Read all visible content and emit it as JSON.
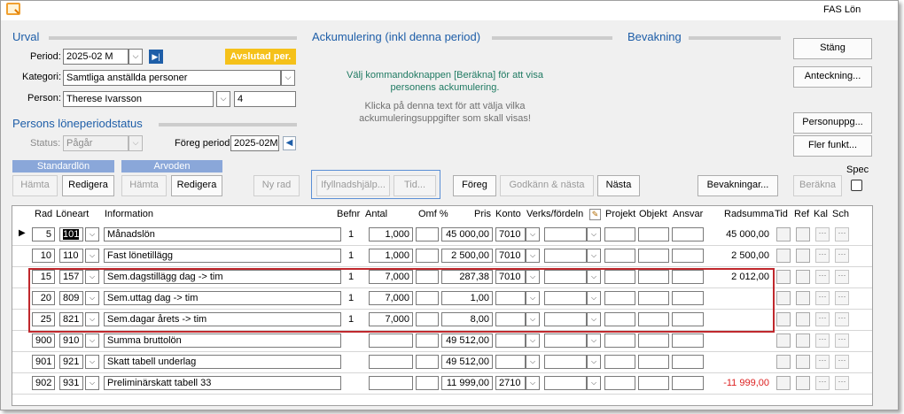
{
  "app": {
    "title": "FAS Lön"
  },
  "urval": {
    "heading": "Urval",
    "period_label": "Period:",
    "period_value": "2025-02 M",
    "avslutad": "Avslutad per.",
    "kategori_label": "Kategori:",
    "kategori_value": "Samtliga anställda personer",
    "person_label": "Person:",
    "person_value": "Therese Ivarsson",
    "person_number": "4"
  },
  "status": {
    "heading": "Persons löneperiodstatus",
    "status_label": "Status:",
    "status_value": "Pågår",
    "foreg_label": "Föreg period:",
    "foreg_value": "2025-02M"
  },
  "groups": {
    "standardlon": "Standardlön",
    "arvoden": "Arvoden",
    "hamta1": "Hämta",
    "redigera1": "Redigera",
    "hamta2": "Hämta",
    "redigera2": "Redigera",
    "nyrad": "Ny rad"
  },
  "ackumulering": {
    "heading": "Ackumulering (inkl denna period)",
    "line1": "Välj kommandoknappen [Beräkna] för att visa",
    "line2": "personens ackumulering.",
    "line3": "Klicka på denna text för att välja vilka",
    "line4": "ackumuleringsuppgifter som skall visas!"
  },
  "bevakning": {
    "heading": "Bevakning"
  },
  "buttons": {
    "stang": "Stäng",
    "anteckning": "Anteckning...",
    "personuppg": "Personuppg...",
    "fler": "Fler funkt...",
    "ifyllnad": "Ifyllnadshjälp...",
    "tid": "Tid...",
    "foreg": "Föreg",
    "godkann": "Godkänn & nästa",
    "nasta": "Nästa",
    "bevakningar": "Bevakningar...",
    "berakna": "Beräkna",
    "spec": "Spec"
  },
  "grid": {
    "headers": {
      "rad": "Rad",
      "loneart": "Löneart",
      "information": "Information",
      "befnr": "Befnr",
      "antal": "Antal",
      "omf": "Omf %",
      "pris": "Pris",
      "konto": "Konto",
      "verks": "Verks/fördeln",
      "projekt": "Projekt",
      "objekt": "Objekt",
      "ansvar": "Ansvar",
      "radsumma": "Radsumma",
      "tid": "Tid",
      "ref": "Ref",
      "kal": "Kal",
      "sch": "Sch"
    },
    "rows": [
      {
        "rad": "5",
        "loneart": "101",
        "info": "Månadslön",
        "befnr": "1",
        "antal": "1,000",
        "pris": "45 000,00",
        "konto": "7010",
        "radsumma": "45 000,00"
      },
      {
        "rad": "10",
        "loneart": "110",
        "info": "Fast lönetillägg",
        "befnr": "1",
        "antal": "1,000",
        "pris": "2 500,00",
        "konto": "7010",
        "radsumma": "2 500,00"
      },
      {
        "rad": "15",
        "loneart": "157",
        "info": "Sem.dagstillägg dag -> tim",
        "befnr": "1",
        "antal": "7,000",
        "pris": "287,38",
        "konto": "7010",
        "radsumma": "2 012,00"
      },
      {
        "rad": "20",
        "loneart": "809",
        "info": "Sem.uttag dag -> tim",
        "befnr": "1",
        "antal": "7,000",
        "pris": "1,00",
        "konto": "",
        "radsumma": ""
      },
      {
        "rad": "25",
        "loneart": "821",
        "info": "Sem.dagar årets -> tim",
        "befnr": "1",
        "antal": "7,000",
        "pris": "8,00",
        "konto": "",
        "radsumma": ""
      },
      {
        "rad": "900",
        "loneart": "910",
        "info": "Summa bruttolön",
        "befnr": "",
        "antal": "",
        "pris": "49 512,00",
        "konto": "",
        "radsumma": ""
      },
      {
        "rad": "901",
        "loneart": "921",
        "info": "Skatt tabell underlag",
        "befnr": "",
        "antal": "",
        "pris": "49 512,00",
        "konto": "",
        "radsumma": ""
      },
      {
        "rad": "902",
        "loneart": "931",
        "info": "Preliminärskatt tabell 33",
        "befnr": "",
        "antal": "",
        "pris": "11 999,00",
        "konto": "2710",
        "radsumma": "-11 999,00"
      }
    ]
  }
}
